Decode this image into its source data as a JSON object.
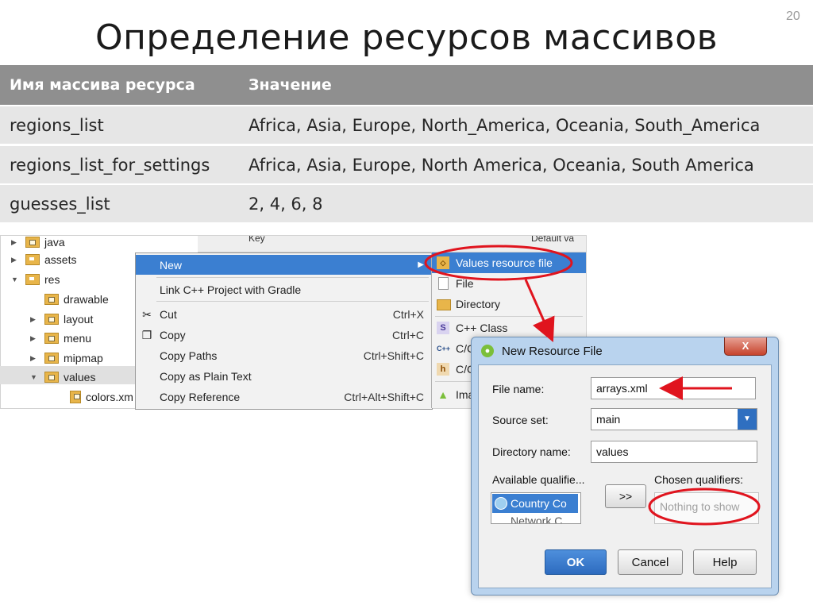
{
  "slide": {
    "number": "20",
    "title": "Определение ресурсов массивов"
  },
  "table": {
    "headers": [
      "Имя массива ресурса",
      "Значение"
    ],
    "rows": [
      [
        "regions_list",
        "Africa, Asia, Europe, North_America, Oceania, South_America"
      ],
      [
        "regions_list_for_settings",
        "Africa, Asia, Europe, North America, Oceania, South America"
      ],
      [
        "guesses_list",
        "2, 4, 6, 8"
      ]
    ]
  },
  "tree": {
    "items": [
      "java",
      "assets",
      "res",
      "drawable",
      "layout",
      "menu",
      "mipmap",
      "values",
      "colors.xm"
    ],
    "bg_header_key": "Key",
    "bg_header_default": "Default va"
  },
  "context_menu": {
    "new": "New",
    "link": "Link C++ Project with Gradle",
    "cut": "Cut",
    "cut_sc": "Ctrl+X",
    "copy": "Copy",
    "copy_sc": "Ctrl+C",
    "copy_paths": "Copy Paths",
    "copy_paths_sc": "Ctrl+Shift+C",
    "copy_plain": "Copy as Plain Text",
    "copy_ref": "Copy Reference",
    "copy_ref_sc": "Ctrl+Alt+Shift+C"
  },
  "submenu": {
    "values_file": "Values resource file",
    "file": "File",
    "directory": "Directory",
    "cpp_class": "C++ Class",
    "c1": "C/C",
    "c2": "C/C",
    "ima": "Ima"
  },
  "dialog": {
    "title": "New Resource File",
    "close": "X",
    "file_name_label": "File name:",
    "file_name_value": "arrays.xml",
    "source_set_label": "Source set:",
    "source_set_value": "main",
    "dir_label": "Directory name:",
    "dir_value": "values",
    "avail_label": "Available qualifie...",
    "avail_item": "Country Co",
    "avail_item2": "Network C",
    "move_btn": ">>",
    "chosen_label": "Chosen qualifiers:",
    "chosen_empty": "Nothing to show",
    "ok": "OK",
    "cancel": "Cancel",
    "help": "Help"
  },
  "colors": {
    "header": "#8f8f8f",
    "row": "#e6e6e6",
    "selection": "#3b7fd1",
    "annotation": "#e0141e"
  }
}
